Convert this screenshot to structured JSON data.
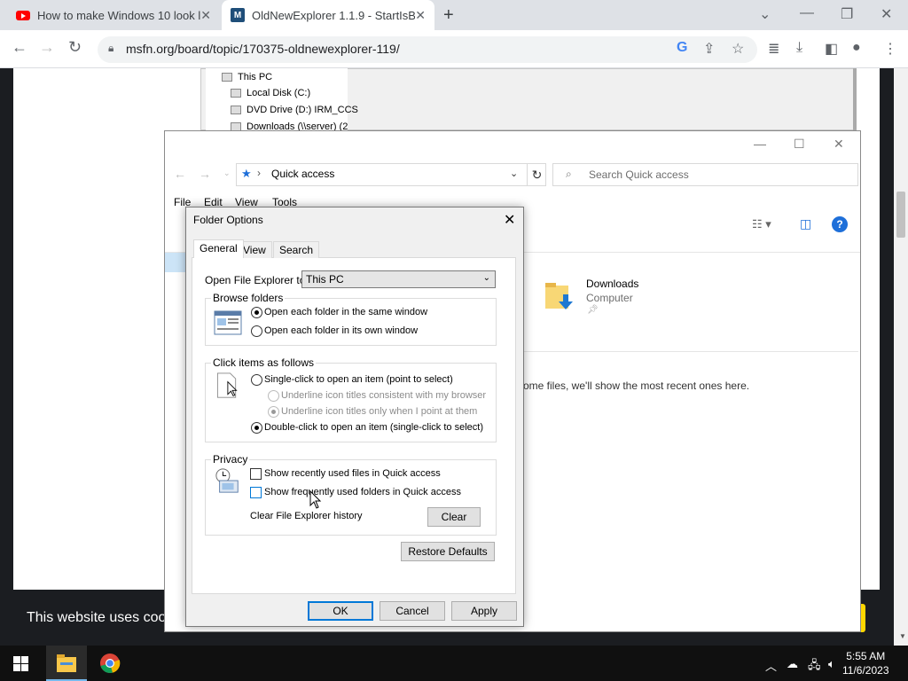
{
  "browser": {
    "tabs": [
      {
        "title": "How to make Windows 10 look l",
        "icon": "youtube-icon"
      },
      {
        "title": "OldNewExplorer 1.1.9 - StartIsBa",
        "icon": "msfn-icon"
      }
    ],
    "url": "msfn.org/board/topic/170375-oldnewexplorer-119/"
  },
  "page": {
    "cookie_text": "This website uses cook",
    "tree": [
      "This PC",
      "Local Disk (C:)",
      "DVD Drive (D:) IRM_CCS",
      "Downloads (\\\\server) (2"
    ]
  },
  "explorer": {
    "address": "Quick access",
    "search_placeholder": "Search Quick access",
    "menu": [
      "File",
      "Edit",
      "View",
      "Tools"
    ],
    "folder_name": "Downloads",
    "folder_location": "Computer",
    "recent_text": "ome files, we'll show the most recent ones here."
  },
  "dialog": {
    "title": "Folder Options",
    "tabs": [
      "General",
      "View",
      "Search"
    ],
    "open_to_label": "Open File Explorer to:",
    "open_to_value": "This PC",
    "browse": {
      "label": "Browse folders",
      "same_window": "Open each folder in the same window",
      "own_window": "Open each folder in its own window"
    },
    "click": {
      "label": "Click items as follows",
      "single": "Single-click to open an item (point to select)",
      "underline_browser": "Underline icon titles consistent with my browser",
      "underline_point": "Underline icon titles only when I point at them",
      "double": "Double-click to open an item (single-click to select)"
    },
    "privacy": {
      "label": "Privacy",
      "recent_files": "Show recently used files in Quick access",
      "frequent_folders": "Show frequently used folders in Quick access",
      "clear_label": "Clear File Explorer history",
      "clear_button": "Clear"
    },
    "restore_defaults": "Restore Defaults",
    "ok": "OK",
    "cancel": "Cancel",
    "apply": "Apply"
  },
  "taskbar": {
    "time": "5:55 AM",
    "date": "11/6/2023"
  }
}
